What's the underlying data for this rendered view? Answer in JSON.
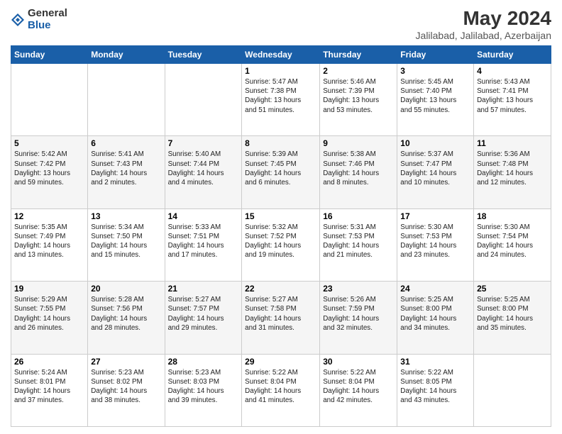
{
  "header": {
    "logo_general": "General",
    "logo_blue": "Blue",
    "month_year": "May 2024",
    "location": "Jalilabad, Jalilabad, Azerbaijan"
  },
  "days_of_week": [
    "Sunday",
    "Monday",
    "Tuesday",
    "Wednesday",
    "Thursday",
    "Friday",
    "Saturday"
  ],
  "weeks": [
    [
      {
        "day": "",
        "info": ""
      },
      {
        "day": "",
        "info": ""
      },
      {
        "day": "",
        "info": ""
      },
      {
        "day": "1",
        "info": "Sunrise: 5:47 AM\nSunset: 7:38 PM\nDaylight: 13 hours\nand 51 minutes."
      },
      {
        "day": "2",
        "info": "Sunrise: 5:46 AM\nSunset: 7:39 PM\nDaylight: 13 hours\nand 53 minutes."
      },
      {
        "day": "3",
        "info": "Sunrise: 5:45 AM\nSunset: 7:40 PM\nDaylight: 13 hours\nand 55 minutes."
      },
      {
        "day": "4",
        "info": "Sunrise: 5:43 AM\nSunset: 7:41 PM\nDaylight: 13 hours\nand 57 minutes."
      }
    ],
    [
      {
        "day": "5",
        "info": "Sunrise: 5:42 AM\nSunset: 7:42 PM\nDaylight: 13 hours\nand 59 minutes."
      },
      {
        "day": "6",
        "info": "Sunrise: 5:41 AM\nSunset: 7:43 PM\nDaylight: 14 hours\nand 2 minutes."
      },
      {
        "day": "7",
        "info": "Sunrise: 5:40 AM\nSunset: 7:44 PM\nDaylight: 14 hours\nand 4 minutes."
      },
      {
        "day": "8",
        "info": "Sunrise: 5:39 AM\nSunset: 7:45 PM\nDaylight: 14 hours\nand 6 minutes."
      },
      {
        "day": "9",
        "info": "Sunrise: 5:38 AM\nSunset: 7:46 PM\nDaylight: 14 hours\nand 8 minutes."
      },
      {
        "day": "10",
        "info": "Sunrise: 5:37 AM\nSunset: 7:47 PM\nDaylight: 14 hours\nand 10 minutes."
      },
      {
        "day": "11",
        "info": "Sunrise: 5:36 AM\nSunset: 7:48 PM\nDaylight: 14 hours\nand 12 minutes."
      }
    ],
    [
      {
        "day": "12",
        "info": "Sunrise: 5:35 AM\nSunset: 7:49 PM\nDaylight: 14 hours\nand 13 minutes."
      },
      {
        "day": "13",
        "info": "Sunrise: 5:34 AM\nSunset: 7:50 PM\nDaylight: 14 hours\nand 15 minutes."
      },
      {
        "day": "14",
        "info": "Sunrise: 5:33 AM\nSunset: 7:51 PM\nDaylight: 14 hours\nand 17 minutes."
      },
      {
        "day": "15",
        "info": "Sunrise: 5:32 AM\nSunset: 7:52 PM\nDaylight: 14 hours\nand 19 minutes."
      },
      {
        "day": "16",
        "info": "Sunrise: 5:31 AM\nSunset: 7:53 PM\nDaylight: 14 hours\nand 21 minutes."
      },
      {
        "day": "17",
        "info": "Sunrise: 5:30 AM\nSunset: 7:53 PM\nDaylight: 14 hours\nand 23 minutes."
      },
      {
        "day": "18",
        "info": "Sunrise: 5:30 AM\nSunset: 7:54 PM\nDaylight: 14 hours\nand 24 minutes."
      }
    ],
    [
      {
        "day": "19",
        "info": "Sunrise: 5:29 AM\nSunset: 7:55 PM\nDaylight: 14 hours\nand 26 minutes."
      },
      {
        "day": "20",
        "info": "Sunrise: 5:28 AM\nSunset: 7:56 PM\nDaylight: 14 hours\nand 28 minutes."
      },
      {
        "day": "21",
        "info": "Sunrise: 5:27 AM\nSunset: 7:57 PM\nDaylight: 14 hours\nand 29 minutes."
      },
      {
        "day": "22",
        "info": "Sunrise: 5:27 AM\nSunset: 7:58 PM\nDaylight: 14 hours\nand 31 minutes."
      },
      {
        "day": "23",
        "info": "Sunrise: 5:26 AM\nSunset: 7:59 PM\nDaylight: 14 hours\nand 32 minutes."
      },
      {
        "day": "24",
        "info": "Sunrise: 5:25 AM\nSunset: 8:00 PM\nDaylight: 14 hours\nand 34 minutes."
      },
      {
        "day": "25",
        "info": "Sunrise: 5:25 AM\nSunset: 8:00 PM\nDaylight: 14 hours\nand 35 minutes."
      }
    ],
    [
      {
        "day": "26",
        "info": "Sunrise: 5:24 AM\nSunset: 8:01 PM\nDaylight: 14 hours\nand 37 minutes."
      },
      {
        "day": "27",
        "info": "Sunrise: 5:23 AM\nSunset: 8:02 PM\nDaylight: 14 hours\nand 38 minutes."
      },
      {
        "day": "28",
        "info": "Sunrise: 5:23 AM\nSunset: 8:03 PM\nDaylight: 14 hours\nand 39 minutes."
      },
      {
        "day": "29",
        "info": "Sunrise: 5:22 AM\nSunset: 8:04 PM\nDaylight: 14 hours\nand 41 minutes."
      },
      {
        "day": "30",
        "info": "Sunrise: 5:22 AM\nSunset: 8:04 PM\nDaylight: 14 hours\nand 42 minutes."
      },
      {
        "day": "31",
        "info": "Sunrise: 5:22 AM\nSunset: 8:05 PM\nDaylight: 14 hours\nand 43 minutes."
      },
      {
        "day": "",
        "info": ""
      }
    ]
  ]
}
